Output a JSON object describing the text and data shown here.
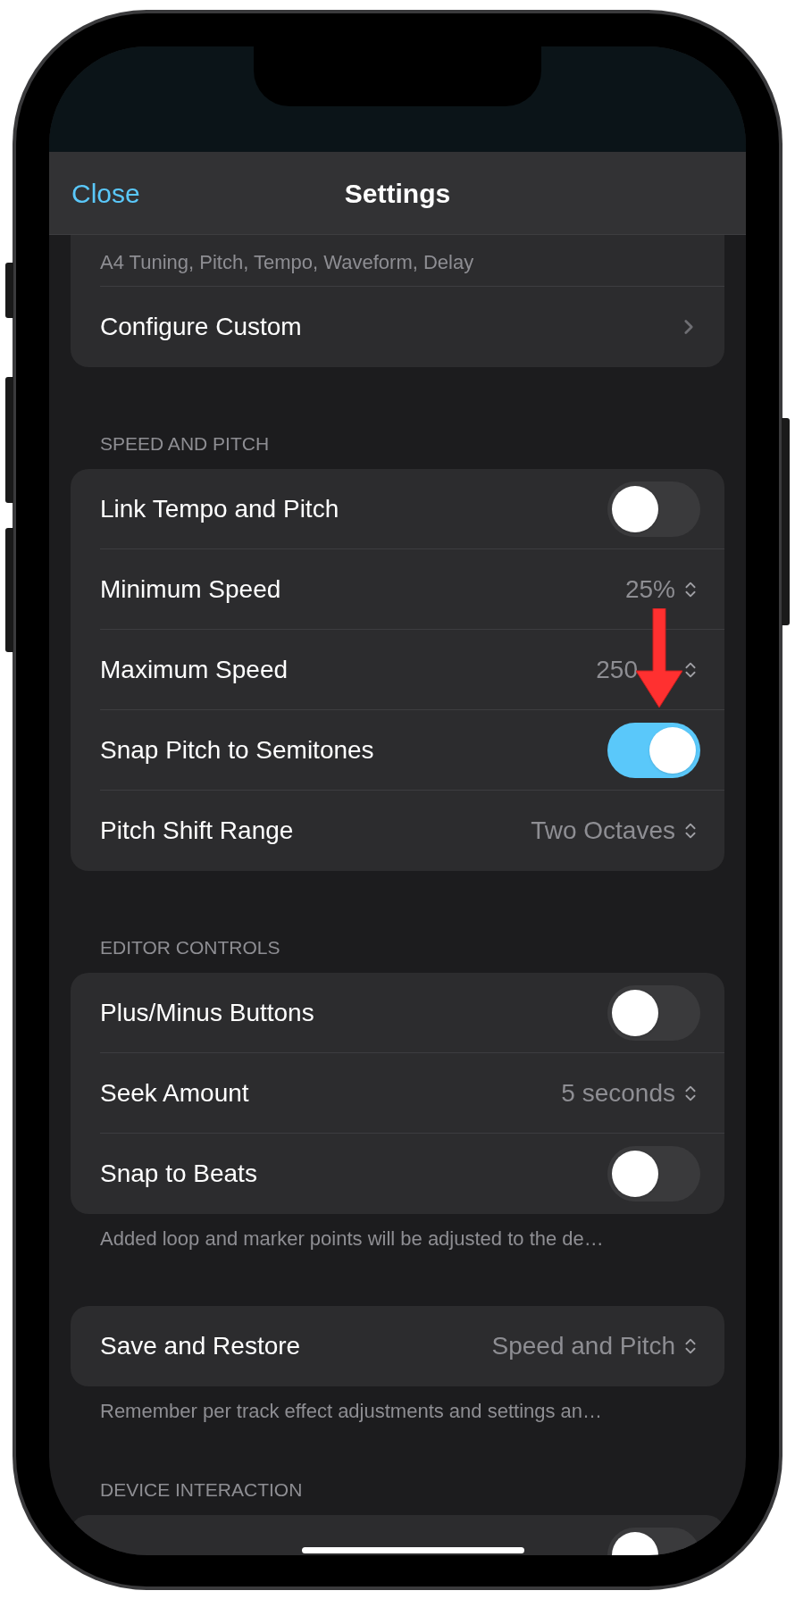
{
  "nav": {
    "back": "Close",
    "title": "Settings"
  },
  "sections": [
    {
      "rows": [
        {
          "kind": "subtitle",
          "subtitle": "A4 Tuning, Pitch, Tempo, Waveform, Delay"
        },
        {
          "kind": "link",
          "title": "Configure Custom"
        }
      ]
    },
    {
      "header": "SPEED AND PITCH",
      "rows": [
        {
          "kind": "toggle",
          "title": "Link Tempo and Pitch",
          "on": false
        },
        {
          "kind": "picker",
          "title": "Minimum Speed",
          "value": "25%"
        },
        {
          "kind": "picker",
          "title": "Maximum Speed",
          "value": "250",
          "annotated": true
        },
        {
          "kind": "toggle",
          "title": "Snap Pitch to Semitones",
          "on": true
        },
        {
          "kind": "picker",
          "title": "Pitch Shift Range",
          "value": "Two Octaves"
        }
      ]
    },
    {
      "header": "EDITOR CONTROLS",
      "rows": [
        {
          "kind": "toggle",
          "title": "Plus/Minus Buttons",
          "on": false
        },
        {
          "kind": "picker",
          "title": "Seek Amount",
          "value": "5 seconds"
        },
        {
          "kind": "toggle",
          "title": "Snap to Beats",
          "on": false
        }
      ],
      "footer": "Added loop and marker points will be adjusted to the de…"
    },
    {
      "rows": [
        {
          "kind": "picker",
          "title": "Save and Restore",
          "value": "Speed and Pitch"
        }
      ],
      "footer": "Remember per track effect adjustments and settings an…"
    },
    {
      "header": "DEVICE INTERACTION",
      "rows": [
        {
          "kind": "toggle",
          "on": false
        }
      ]
    }
  ]
}
